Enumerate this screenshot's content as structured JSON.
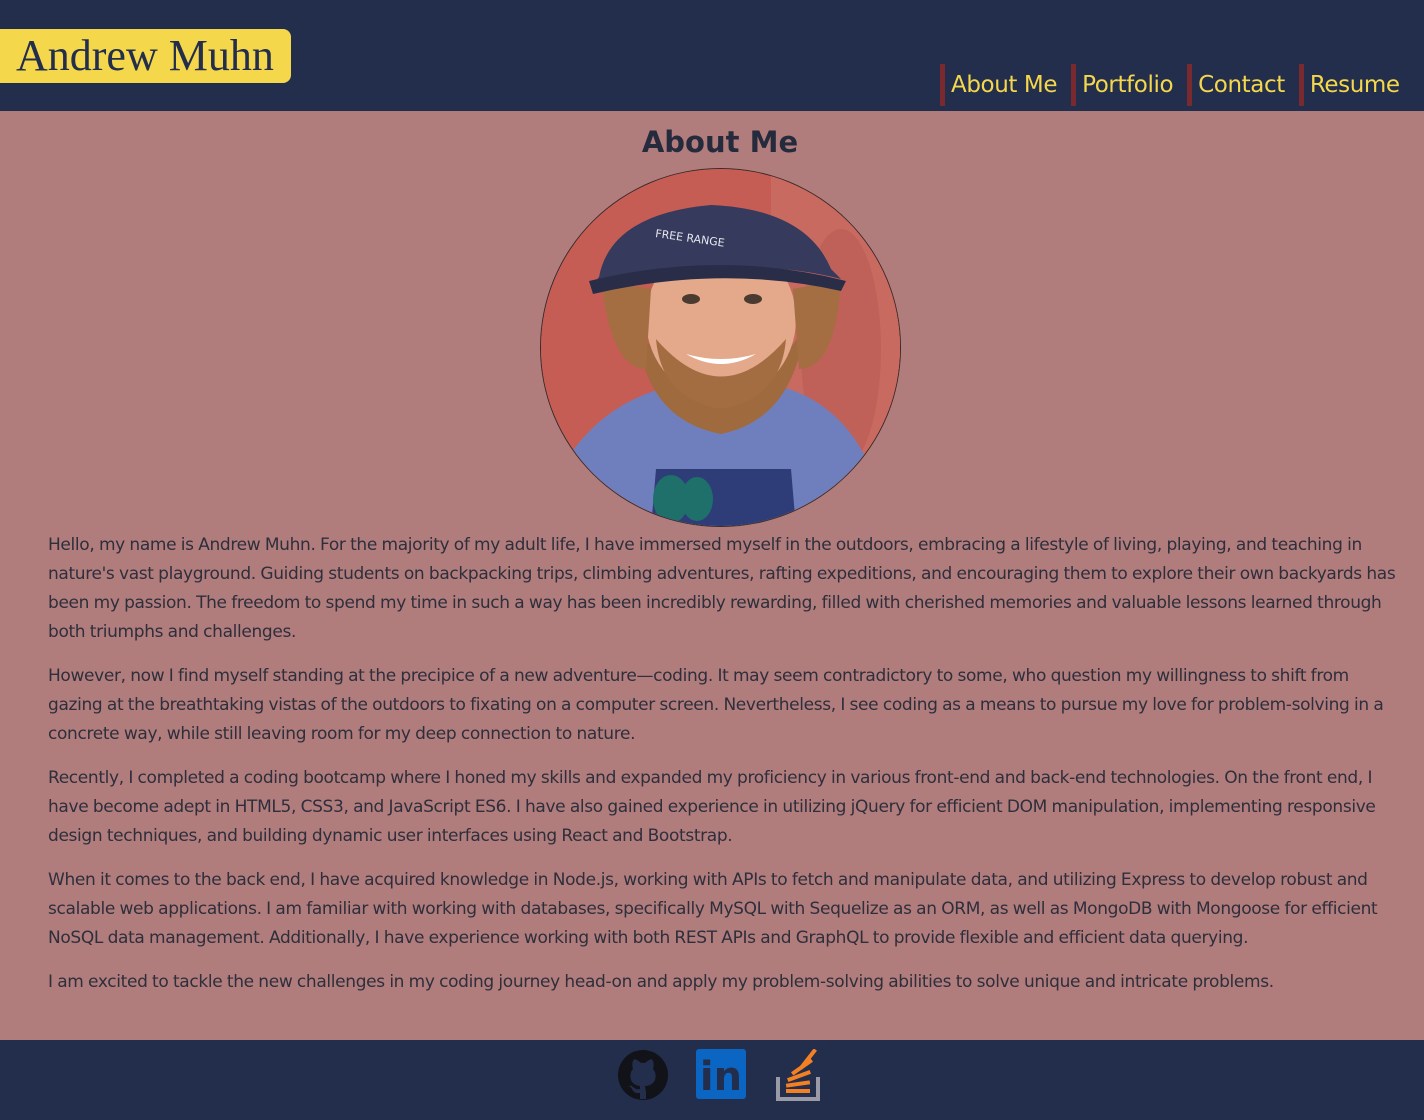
{
  "header": {
    "brand": "Andrew Muhn",
    "nav": [
      "About Me",
      "Portfolio",
      "Contact",
      "Resume"
    ]
  },
  "main": {
    "title": "About Me",
    "paragraphs": [
      "Hello, my name is Andrew Muhn. For the majority of my adult life, I have immersed myself in the outdoors, embracing a lifestyle of living, playing, and teaching in nature's vast playground. Guiding students on backpacking trips, climbing adventures, rafting expeditions, and encouraging them to explore their own backyards has been my passion. The freedom to spend my time in such a way has been incredibly rewarding, filled with cherished memories and valuable lessons learned through both triumphs and challenges.",
      "However, now I find myself standing at the precipice of a new adventure—coding. It may seem contradictory to some, who question my willingness to shift from gazing at the breathtaking vistas of the outdoors to fixating on a computer screen. Nevertheless, I see coding as a means to pursue my love for problem-solving in a concrete way, while still leaving room for my deep connection to nature.",
      "Recently, I completed a coding bootcamp where I honed my skills and expanded my proficiency in various front-end and back-end technologies. On the front end, I have become adept in HTML5, CSS3, and JavaScript ES6. I have also gained experience in utilizing jQuery for efficient DOM manipulation, implementing responsive design techniques, and building dynamic user interfaces using React and Bootstrap.",
      "When it comes to the back end, I have acquired knowledge in Node.js, working with APIs to fetch and manipulate data, and utilizing Express to develop robust and scalable web applications. I am familiar with working with databases, specifically MySQL with Sequelize as an ORM, as well as MongoDB with Mongoose for efficient NoSQL data management. Additionally, I have experience working with both REST APIs and GraphQL to provide flexible and efficient data querying.",
      "I am excited to tackle the new challenges in my coding journey head-on and apply my problem-solving abilities to solve unique and intricate problems."
    ],
    "hat_text": "FREE RANGE"
  },
  "footer": {
    "icons": [
      "github-icon",
      "linkedin-icon",
      "stackoverflow-icon"
    ],
    "linkedin_text": "in"
  },
  "colors": {
    "header_bg": "#232e4c",
    "page_bg": "#b07d7c",
    "brand_bg": "#f5d74c",
    "nav_text": "#f5d74c",
    "nav_border": "#7a2a2e",
    "linkedin": "#0a66c2",
    "stackoverflow": "#f48024"
  }
}
